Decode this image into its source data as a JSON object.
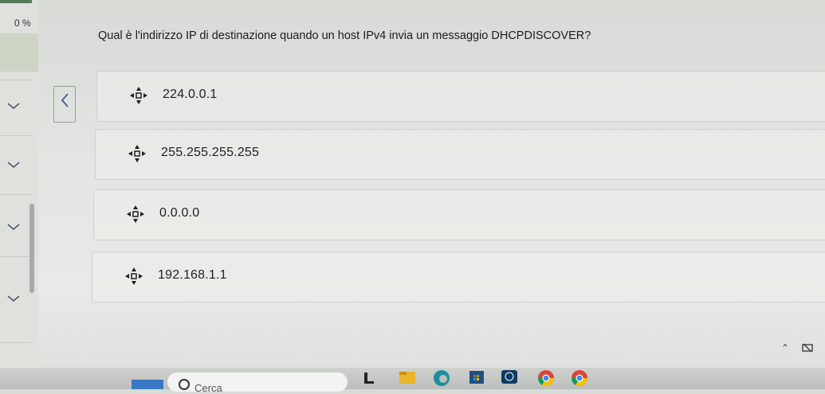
{
  "progress": {
    "label": "0 %",
    "value_percent": 0
  },
  "question": {
    "text": "Qual è l'indirizzo IP di destinazione quando un host IPv4 invia un messaggio DHCPDISCOVER?"
  },
  "navigation": {
    "back_icon": "chevron-left-icon"
  },
  "options": [
    {
      "label": "224.0.0.1",
      "icon": "drag-handle-icon"
    },
    {
      "label": "255.255.255.255",
      "icon": "drag-handle-icon"
    },
    {
      "label": "0.0.0.0",
      "icon": "drag-handle-icon"
    },
    {
      "label": "192.168.1.1",
      "icon": "drag-handle-icon"
    }
  ],
  "sidebar": {
    "chevron_icon": "chevron-down-icon"
  },
  "taskbar": {
    "search_placeholder": "Cerca",
    "pinned_icons": [
      "file-explorer-icon",
      "folder-icon",
      "edge-icon",
      "store-icon",
      "dell-icon",
      "chrome-icon",
      "chrome-icon"
    ],
    "tray_icons": [
      "chevron-up-icon",
      "network-icon"
    ]
  },
  "colors": {
    "accent": "#57795a",
    "nav_blue": "#3f5d8e",
    "taskbar": "#c4c6c4"
  }
}
